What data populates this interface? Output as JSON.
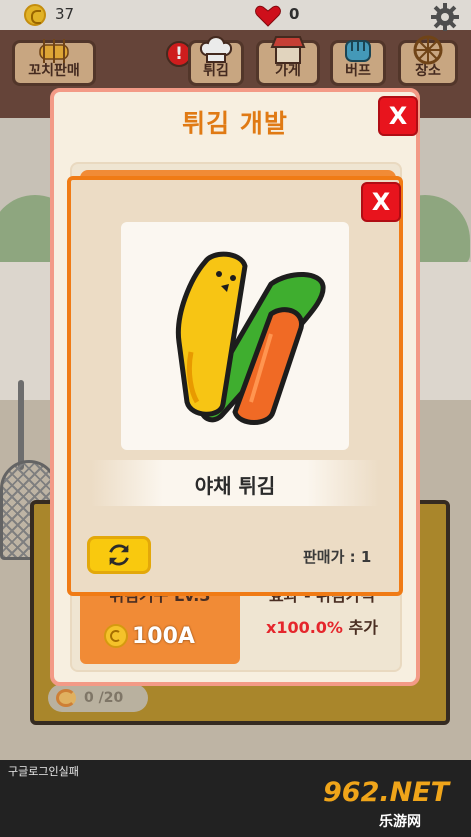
{
  "hud": {
    "coins": "37",
    "hearts": "0"
  },
  "nav": {
    "skewer_sale": "꼬치판매",
    "fry": "튀김",
    "shop": "가게",
    "buff": "버프",
    "decoration": "장소",
    "alert_mark": "!"
  },
  "dev_panel": {
    "title": "튀김 개발",
    "close": "X",
    "upgrade_level": "튀김기구 Lv.3",
    "upgrade_cost": "100A",
    "effect_label": "효과 - 튀김가격",
    "effect_multiplier": "x100.0%",
    "effect_suffix": "추가"
  },
  "item_card": {
    "close": "X",
    "name": "야채 튀김",
    "price": "판매가 : 1",
    "image_icon": "vegetable-tempura-icon"
  },
  "basket": {
    "count": "0 /20"
  },
  "footer": {
    "status": "구글로그인실패",
    "watermark_big": "962.NET",
    "watermark_small": "乐游网"
  },
  "colors": {
    "accent": "#f07b15",
    "close_red": "#e8141d",
    "coin": "#f5c22a"
  }
}
